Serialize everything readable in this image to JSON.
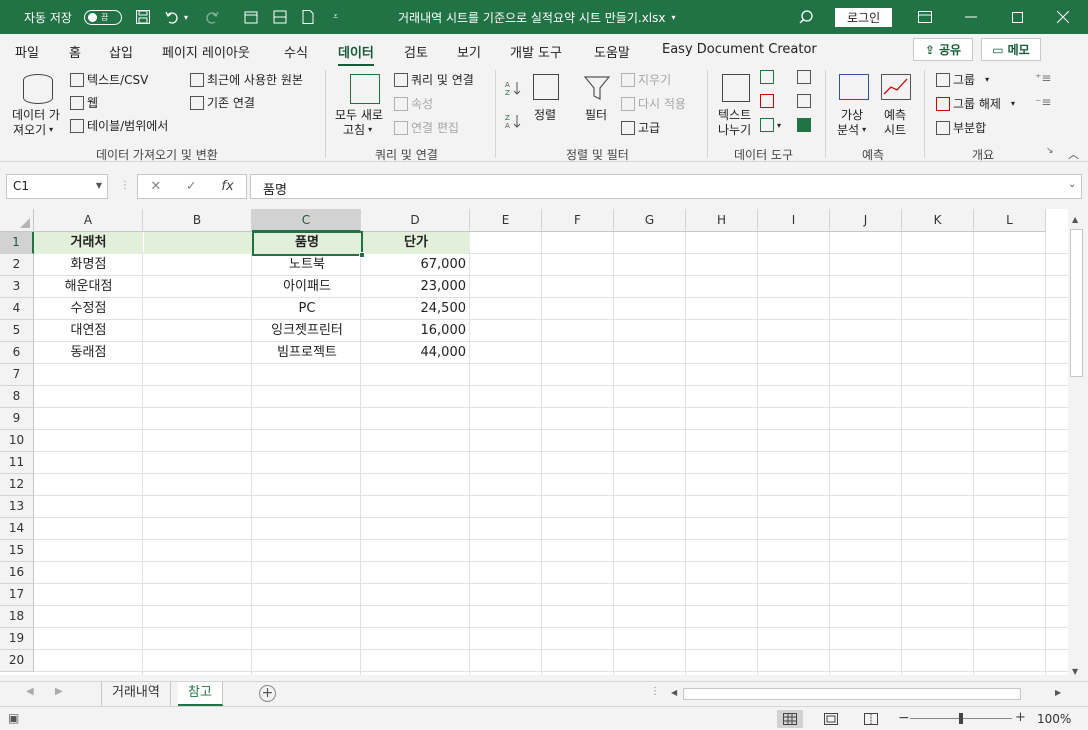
{
  "titlebar": {
    "autosave_label": "자동 저장",
    "autosave_state": "끔",
    "document_title": "거래내역 시트를 기준으로 실적요약 시트 만들기.xlsx",
    "signin_label": "로그인"
  },
  "tabs": [
    "파일",
    "홈",
    "삽입",
    "페이지 레이아웃",
    "수식",
    "데이터",
    "검토",
    "보기",
    "개발 도구",
    "도움말",
    "Easy Document Creator"
  ],
  "active_tab": "데이터",
  "share_label": "공유",
  "memo_label": "메모",
  "ribbon": {
    "get_data": "데이터 가",
    "get_data2": "져오기",
    "from_text": "텍스트/CSV",
    "from_web": "웹",
    "from_table": "테이블/범위에서",
    "recent_sources": "최근에 사용한 원본",
    "existing_conn": "기존 연결",
    "refresh_all": "모두 새로",
    "refresh_all2": "고침",
    "queries_conn": "쿼리 및 연결",
    "properties": "속성",
    "edit_links": "연결 편집",
    "sort": "정렬",
    "filter": "필터",
    "clear": "지우기",
    "reapply": "다시 적용",
    "advanced": "고급",
    "text_to_cols": "텍스트",
    "text_to_cols2": "나누기",
    "whatif": "가상",
    "whatif2": "분석",
    "forecast": "예측",
    "forecast2": "시트",
    "group": "그룹",
    "ungroup": "그룹 해제",
    "subtotal": "부분합",
    "groups": {
      "get_transform": "데이터 가져오기 및 변환",
      "queries": "쿼리 및 연결",
      "sort_filter": "정렬 및 필터",
      "data_tools": "데이터 도구",
      "forecast": "예측",
      "outline": "개요"
    }
  },
  "formula_bar": {
    "name_box": "C1",
    "fx": "fx",
    "content": "품명"
  },
  "columns": [
    "A",
    "B",
    "C",
    "D",
    "E",
    "F",
    "G",
    "H",
    "I",
    "J",
    "K",
    "L"
  ],
  "rows": [
    "1",
    "2",
    "3",
    "4",
    "5",
    "6",
    "7",
    "8",
    "9",
    "10",
    "11",
    "12",
    "13",
    "14",
    "15",
    "16",
    "17",
    "18",
    "19",
    "20"
  ],
  "selected_cell": "C1",
  "table": {
    "headers": {
      "A": "거래처",
      "C": "품명",
      "D": "단가"
    },
    "A": [
      "화명점",
      "해운대점",
      "수정점",
      "대연점",
      "동래점"
    ],
    "C": [
      "노트북",
      "아이패드",
      "PC",
      "잉크젯프린터",
      "빔프로젝트"
    ],
    "D": [
      "67,000",
      "23,000",
      "24,500",
      "16,000",
      "44,000"
    ]
  },
  "sheets": [
    "거래내역",
    "참고"
  ],
  "active_sheet": "참고",
  "zoom": "100%",
  "colors": {
    "accent": "#217346",
    "header_fill": "#e2efda"
  }
}
